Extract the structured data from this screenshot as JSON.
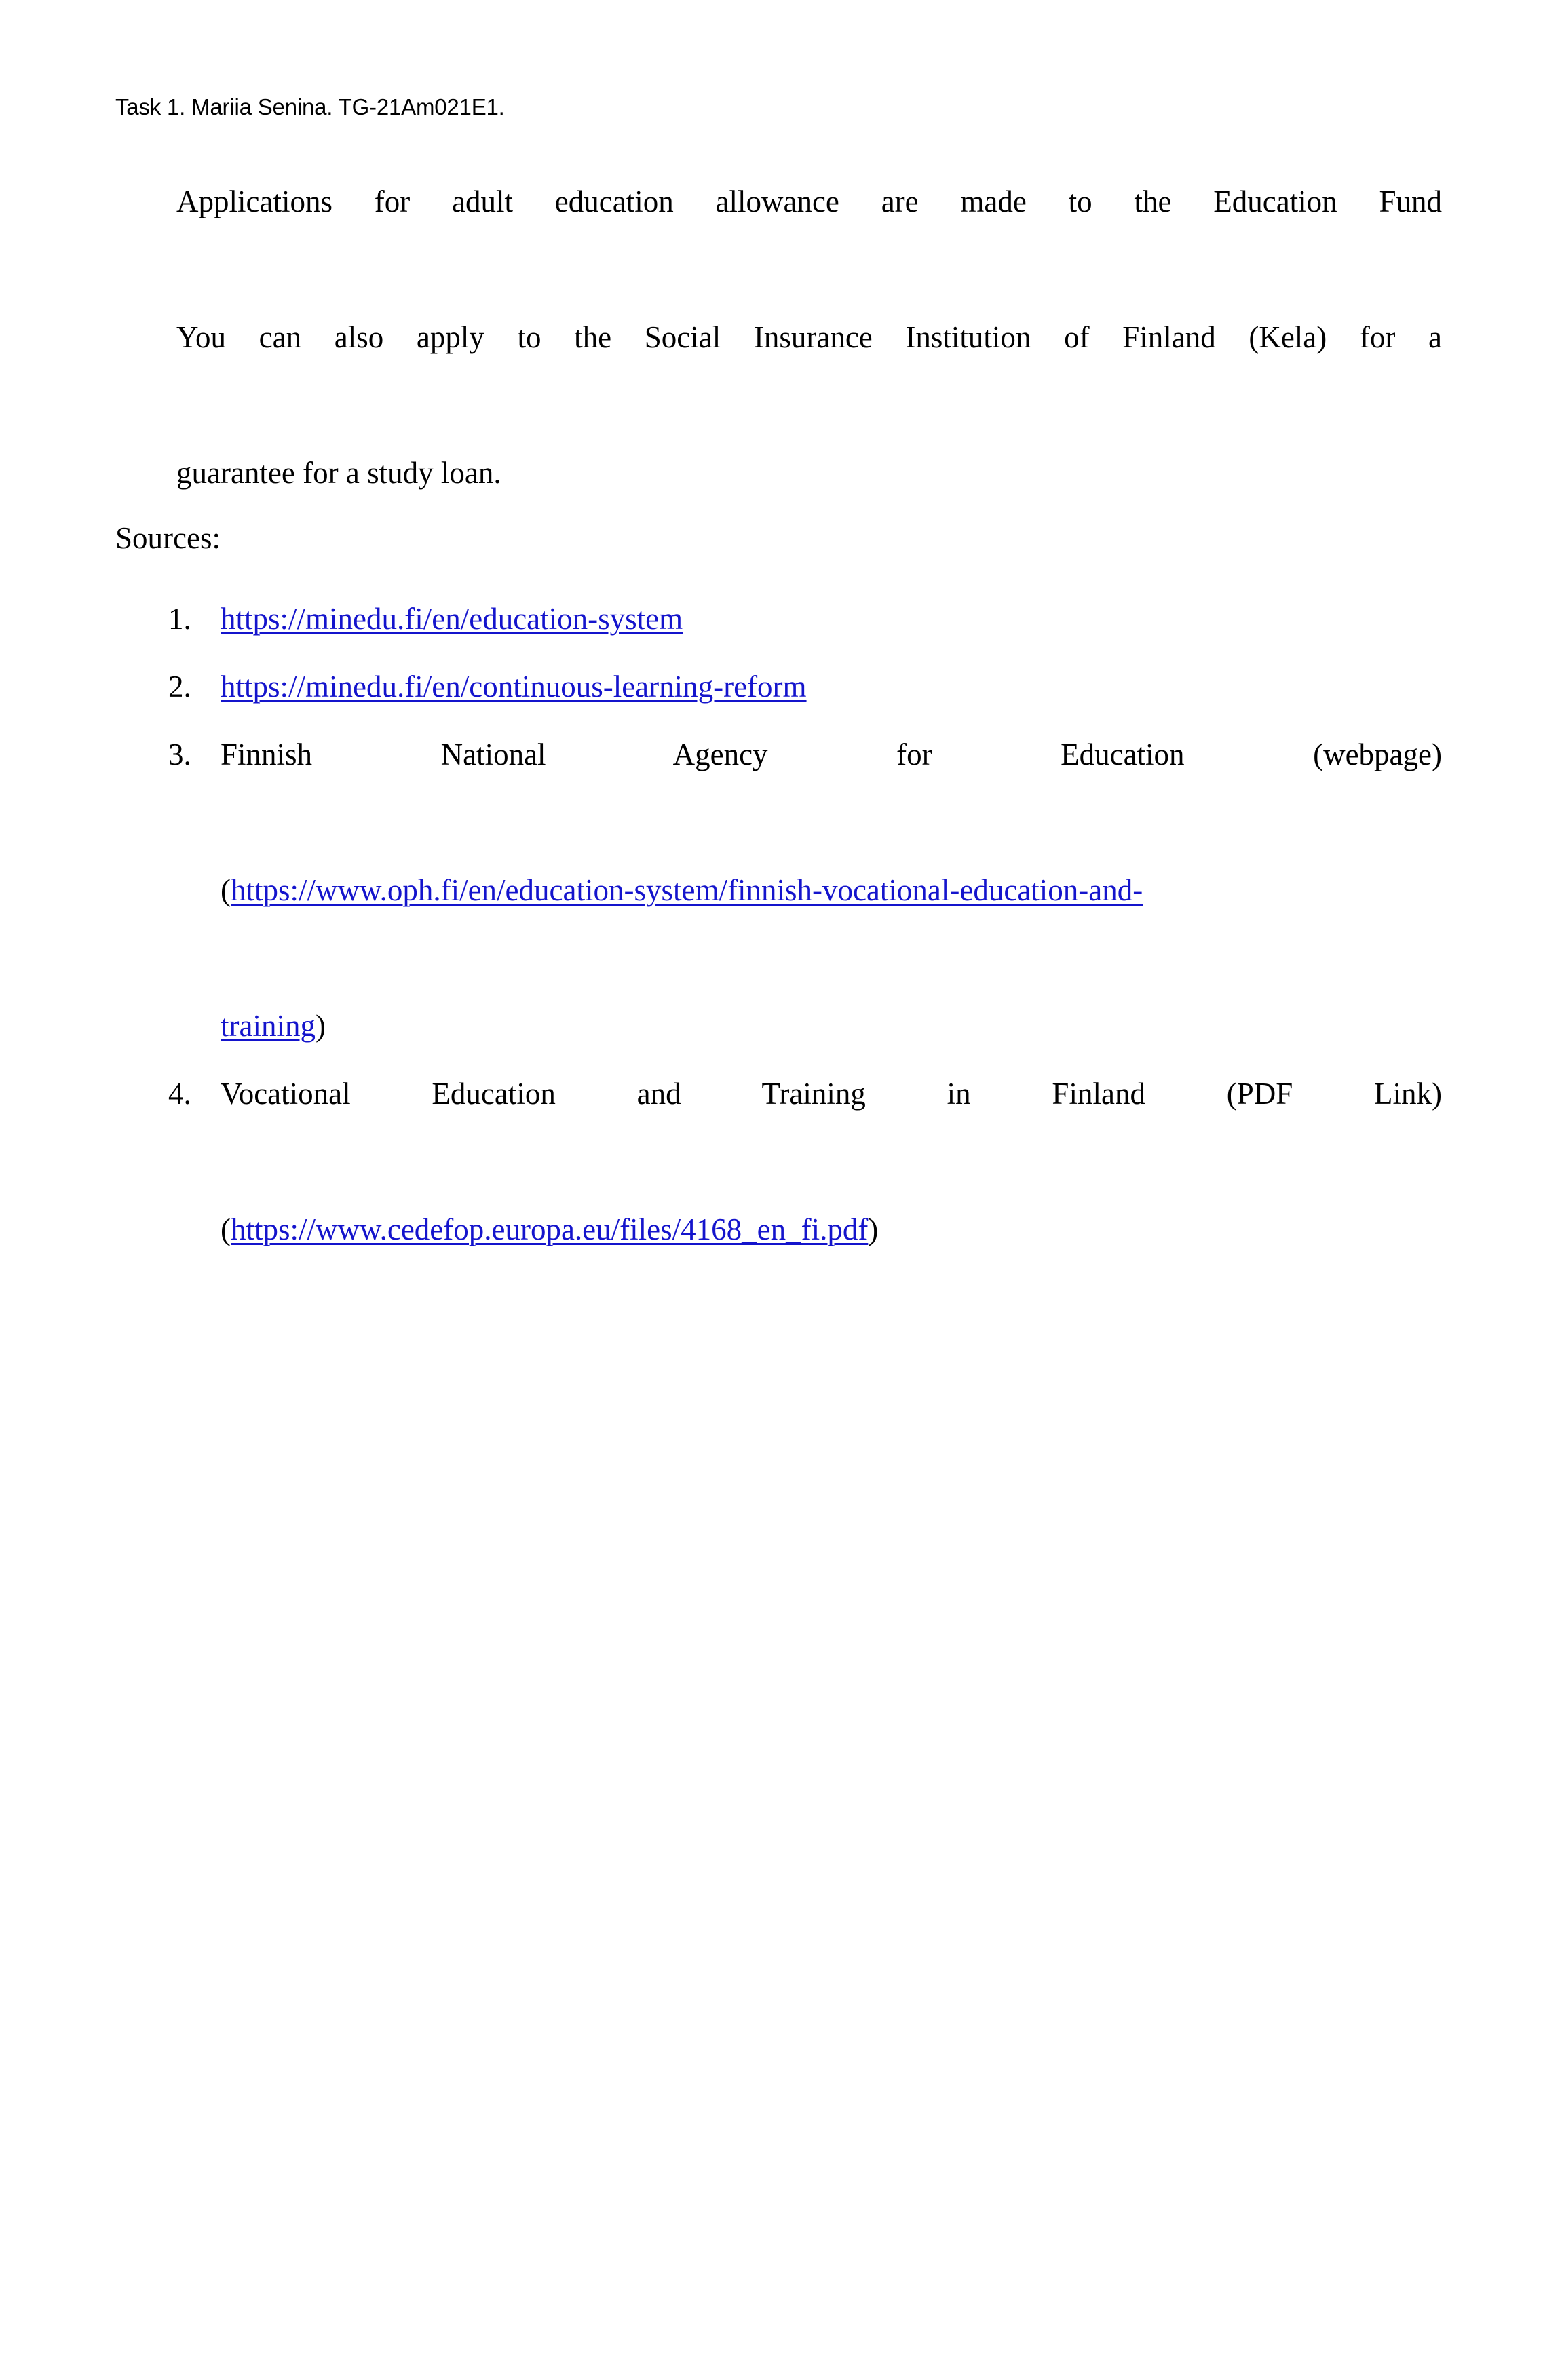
{
  "page": {
    "background_color": "#ffffff",
    "text_color": "#000000",
    "link_color": "#1414CC"
  },
  "header": {
    "running_title": "Task 1. Mariia Senina. TG-21Am021E1."
  },
  "body": {
    "paragraph_lines": [
      "Applications for adult education allowance are made to the Education Fund",
      "You can also apply to the Social Insurance Institution of Finland (Kela) for a",
      "guarantee for a study loan."
    ],
    "paragraph_full": "Applications for adult education allowance are made to the Education Fund You can also apply to the Social Insurance Institution of Finland (Kela) for a guarantee for a study loan."
  },
  "sources": {
    "heading": "Sources:",
    "items": [
      {
        "number": "1.",
        "kind": "link-only",
        "link_text": "https://minedu.fi/en/education-system"
      },
      {
        "number": "2.",
        "kind": "link-only",
        "link_text": "https://minedu.fi/en/continuous-learning-reform"
      },
      {
        "number": "3.",
        "kind": "title-with-link",
        "title_line": "Finnish National Agency for Education (webpage)",
        "title_words": [
          "Finnish",
          "National",
          "Agency",
          "for",
          "Education",
          "(webpage)"
        ],
        "open_paren": "(",
        "link_text_line1": "https://www.oph.fi/en/education-system/finnish-vocational-education-and-",
        "link_text_line2": "training",
        "close_paren": ")",
        "link_full": "https://www.oph.fi/en/education-system/finnish-vocational-education-and-training"
      },
      {
        "number": "4.",
        "kind": "title-with-link",
        "title_line": "Vocational Education and Training in Finland (PDF Link)",
        "title_words": [
          "Vocational",
          "Education",
          "and",
          "Training",
          "in",
          "Finland",
          "(PDF",
          "Link)"
        ],
        "open_paren": "(",
        "link_text_line1": "https://www.cedefop.europa.eu/files/4168_en_fi.pdf",
        "close_paren": ")",
        "link_full": "https://www.cedefop.europa.eu/files/4168_en_fi.pdf"
      }
    ]
  }
}
